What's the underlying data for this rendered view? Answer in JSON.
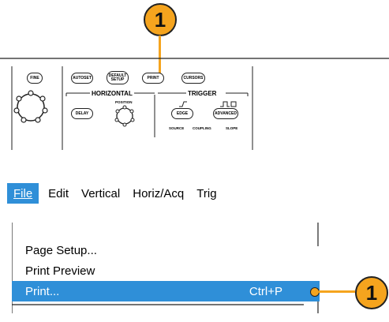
{
  "callout_top": {
    "number": "1"
  },
  "callout_bottom": {
    "number": "1"
  },
  "panel": {
    "buttons": {
      "fine": "FINE",
      "autoset": "AUTOSET",
      "default_setup": "DEFAULT SETUP",
      "print": "PRINT",
      "cursors": "CURSORS",
      "delay": "DELAY",
      "edge": "EDGE",
      "advanced": "ADVANCED"
    },
    "horizontal_label": "HORIZONTAL",
    "trigger_label": "TRIGGER",
    "position_label": "POSITION",
    "source_label": "SOURCE",
    "coupling_label": "COUPLING",
    "slope_label": "SLOPE"
  },
  "menubar": {
    "file": "File",
    "edit": "Edit",
    "vertical": "Vertical",
    "horiz_acq": "Horiz/Acq",
    "trig": "Trig"
  },
  "file_menu": {
    "page_setup": "Page Setup...",
    "print_preview": "Print Preview",
    "print": "Print...",
    "print_shortcut": "Ctrl+P"
  },
  "colors": {
    "callout": "#f5a41e",
    "highlight": "#2f8fd8"
  }
}
